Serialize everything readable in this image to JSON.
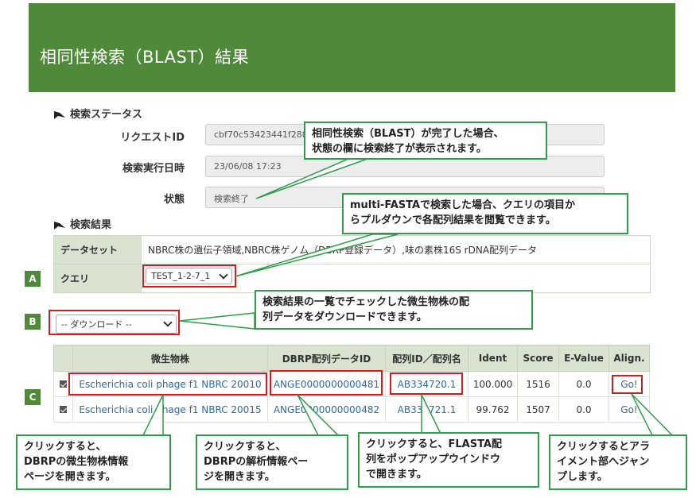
{
  "header": {
    "title": "相同性検索（BLAST）結果"
  },
  "status_section": {
    "title": "検索ステータス",
    "request_id_label": "リクエストID",
    "request_id_value": "cbf70c53423441f2881",
    "exec_datetime_label": "検索実行日時",
    "exec_datetime_value": "23/06/08 17:23",
    "state_label": "状態",
    "state_value": "検索終了"
  },
  "results_section": {
    "title": "検索結果",
    "dataset_label": "データセット",
    "dataset_value": "NBRC株の遺伝子領域,NBRC株ゲノム（DBRP登録データ）,味の素株16S rDNA配列データ",
    "query_label": "クエリ",
    "query_value": "TEST_1-2-7_1"
  },
  "download_select": {
    "value": "-- ダウンロード --"
  },
  "badges": {
    "a": "A",
    "b": "B",
    "c": "C"
  },
  "table": {
    "headers": [
      "微生物株",
      "DBRP配列データID",
      "配列ID／配列名",
      "Ident",
      "Score",
      "E-Value",
      "Align."
    ],
    "rows": [
      {
        "strain": "Escherichia coli phage f1 NBRC 20010",
        "dbrp_id": "ANGE0000000000481",
        "seq_id": "AB334720.1",
        "ident": "100.000",
        "score": "1516",
        "evalue": "0.0",
        "align": "Go!"
      },
      {
        "strain": "Escherichia coli phage f1 NBRC 20015",
        "dbrp_id": "ANGE0000000000482",
        "seq_id": "AB334721.1",
        "ident": "99.762",
        "score": "1507",
        "evalue": "0.0",
        "align": "Go!"
      }
    ]
  },
  "callouts": {
    "status": "相同性検索（BLAST）が完了した場合、\n状態の欄に検索終了が表示されます。",
    "query": "multi-FASTAで検索した場合、クエリの項目か\nらプルダウンで各配列結果を閲覧できます。",
    "download": "検索結果の一覧でチェックした微生物株の配\n列データをダウンロードできます。",
    "strain": "クリックすると、\nDBRPの微生物株情報\nページを開きます。",
    "dbrp": "クリックすると、\nDBRPの解析情報ペー\nジを開きます。",
    "seq": "クリックすると、FLASTA配\n列をポップアップウインドウ\nで開きます。",
    "align": "クリックするとアラ\nイメント部へジャン\nプします。"
  },
  "colors": {
    "header_green": "#4f8a3a",
    "callout_border": "#2f9e4a",
    "highlight_red": "#d41c1c",
    "link_blue": "#2b6aa8"
  }
}
